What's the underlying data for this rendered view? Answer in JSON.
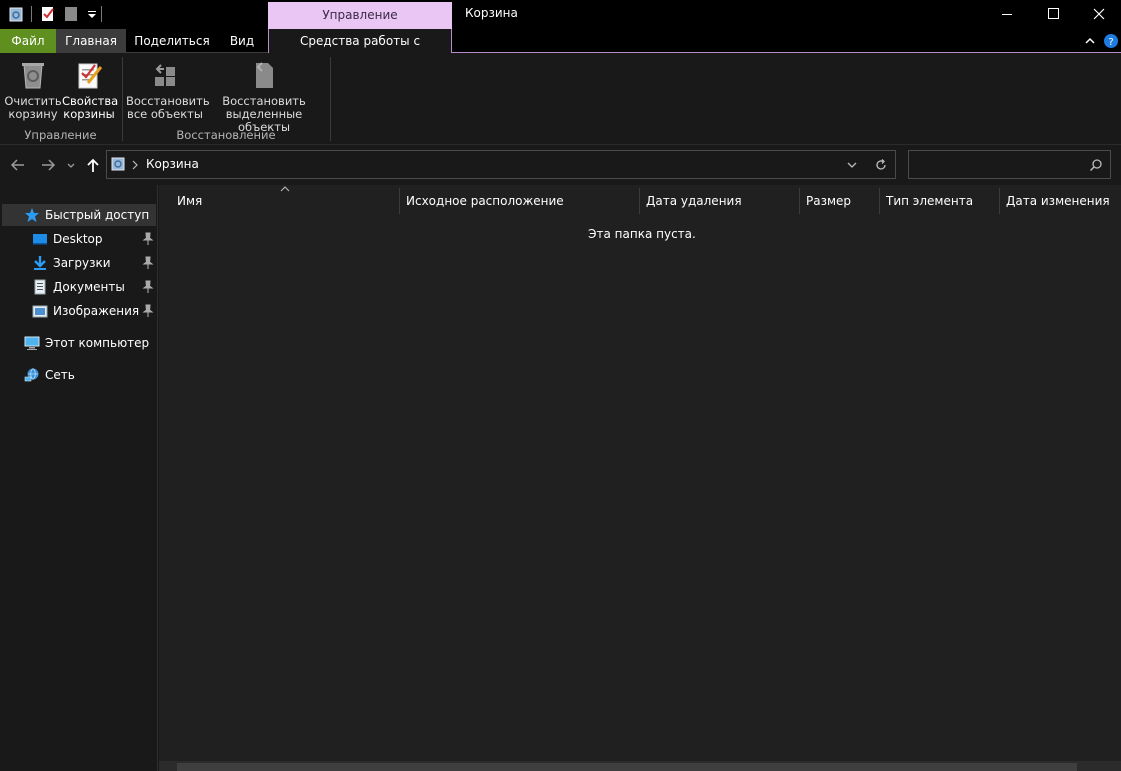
{
  "window": {
    "title": "Корзина",
    "context_tab_header": "Управление"
  },
  "ribbon": {
    "tabs": [
      "Файл",
      "Главная",
      "Поделиться",
      "Вид",
      "Средства работы с корзиной"
    ],
    "groups": {
      "manage": {
        "label": "Управление",
        "buttons": [
          {
            "line1": "Очистить",
            "line2": "корзину",
            "icon": "recycle-bin-icon"
          },
          {
            "line1": "Свойства",
            "line2": "корзины",
            "icon": "properties-icon"
          }
        ]
      },
      "restore": {
        "label": "Восстановление",
        "buttons": [
          {
            "line1": "Восстановить",
            "line2": "все объекты",
            "icon": "restore-all-icon"
          },
          {
            "line1": "Восстановить",
            "line2": "выделенные объекты",
            "icon": "restore-selected-icon"
          }
        ]
      }
    }
  },
  "address": {
    "path": [
      "Корзина"
    ],
    "search_placeholder": ""
  },
  "sidebar": {
    "quick_access": "Быстрый доступ",
    "items": [
      {
        "label": "Desktop",
        "pinned": true
      },
      {
        "label": "Загрузки",
        "pinned": true
      },
      {
        "label": "Документы",
        "pinned": true
      },
      {
        "label": "Изображения",
        "pinned": true
      }
    ],
    "this_pc": "Этот компьютер",
    "network": "Сеть"
  },
  "columns": [
    "Имя",
    "Исходное расположение",
    "Дата удаления",
    "Размер",
    "Тип элемента",
    "Дата изменения"
  ],
  "empty_message": "Эта папка пуста.",
  "colors": {
    "file_tab": "#5e8f1f",
    "context_tab": "#e9c6f4",
    "background": "#191919",
    "content_background": "#202020"
  }
}
